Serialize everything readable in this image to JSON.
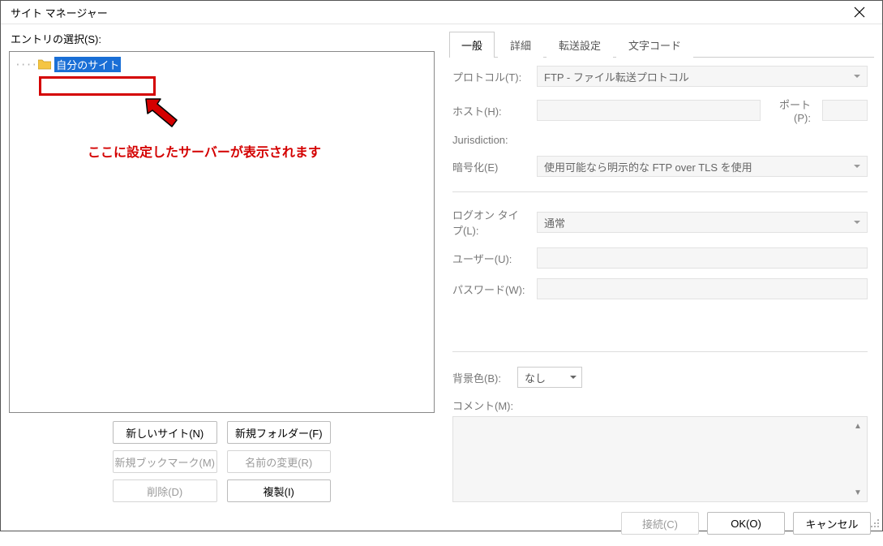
{
  "title": "サイト マネージャー",
  "left": {
    "entry_label": "エントリの選択(S):",
    "tree_root": "自分のサイト",
    "annotation_text": "ここに設定したサーバーが表示されます",
    "buttons": {
      "new_site": "新しいサイト(N)",
      "new_folder": "新規フォルダー(F)",
      "new_bookmark": "新規ブックマーク(M)",
      "rename": "名前の変更(R)",
      "delete": "削除(D)",
      "duplicate": "複製(I)"
    }
  },
  "tabs": {
    "general": "一般",
    "advanced": "詳細",
    "transfer": "転送設定",
    "charset": "文字コード"
  },
  "form": {
    "protocol_label": "プロトコル(T):",
    "protocol_value": "FTP - ファイル転送プロトコル",
    "host_label": "ホスト(H):",
    "port_label": "ポート(P):",
    "jurisdiction_label": "Jurisdiction:",
    "encryption_label": "暗号化(E)",
    "encryption_value": "使用可能なら明示的な FTP over TLS を使用",
    "logon_label": "ログオン タイプ(L):",
    "logon_value": "通常",
    "user_label": "ユーザー(U):",
    "password_label": "パスワード(W):",
    "bgcolor_label": "背景色(B):",
    "bgcolor_value": "なし",
    "comment_label": "コメント(M):"
  },
  "footer": {
    "connect": "接続(C)",
    "ok": "OK(O)",
    "cancel": "キャンセル"
  }
}
